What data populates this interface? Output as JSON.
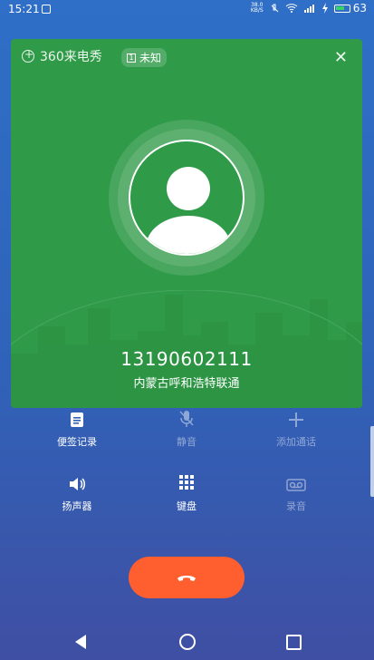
{
  "status_bar": {
    "time": "15:21",
    "speed_value": "38.0",
    "speed_unit": "KB/S",
    "battery": "63"
  },
  "card": {
    "brand": "360来电秀",
    "tag": "未知",
    "phone_number": "13190602111",
    "location": "内蒙古呼和浩特联通"
  },
  "actions": [
    {
      "label": "便签记录",
      "icon": "note-icon"
    },
    {
      "label": "静音",
      "icon": "mute-mic-icon"
    },
    {
      "label": "添加通话",
      "icon": "add-call-icon"
    },
    {
      "label": "扬声器",
      "icon": "speaker-icon"
    },
    {
      "label": "键盘",
      "icon": "keypad-icon"
    },
    {
      "label": "录音",
      "icon": "record-icon"
    }
  ],
  "colors": {
    "card_bg": "#2f9a48",
    "end_button": "#ff5f2e"
  }
}
